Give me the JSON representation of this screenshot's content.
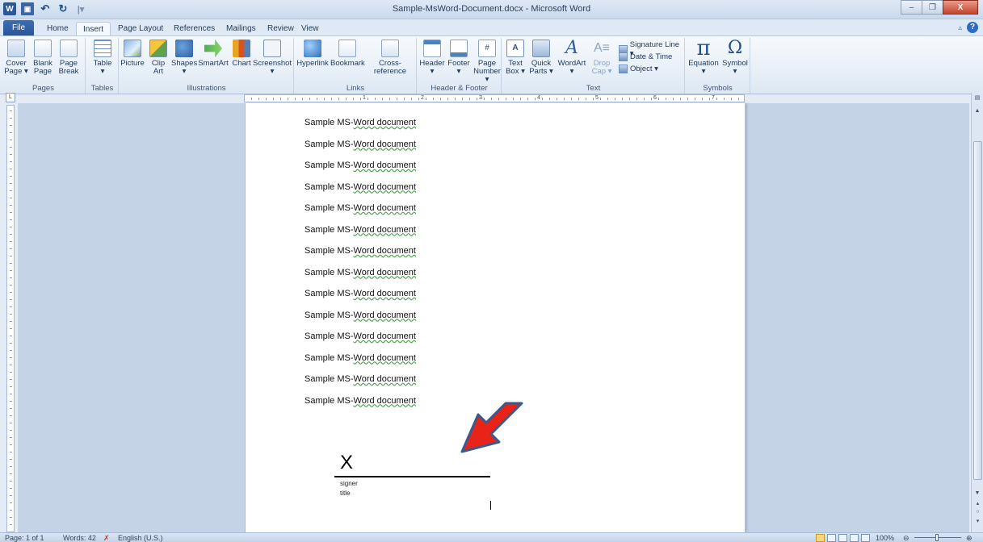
{
  "window": {
    "title": "Sample-MsWord-Document.docx - Microsoft Word",
    "minimize": "–",
    "restore": "❐",
    "close": "X"
  },
  "qat": {
    "word_icon": "W",
    "save_icon": "💾",
    "undo_icon": "↶",
    "redo_icon": "↻",
    "customize": "|▾"
  },
  "tabs": [
    {
      "label": "File"
    },
    {
      "label": "Home"
    },
    {
      "label": "Insert"
    },
    {
      "label": "Page Layout"
    },
    {
      "label": "References"
    },
    {
      "label": "Mailings"
    },
    {
      "label": "Review"
    },
    {
      "label": "View"
    }
  ],
  "active_tab": "Insert",
  "ribbon": {
    "pages": {
      "label": "Pages",
      "cover": "Cover\nPage ▾",
      "blank": "Blank\nPage",
      "break": "Page\nBreak"
    },
    "tables": {
      "label": "Tables",
      "table": "Table\n▾"
    },
    "illustrations": {
      "label": "Illustrations",
      "picture": "Picture",
      "clipart": "Clip\nArt",
      "shapes": "Shapes\n▾",
      "smartart": "SmartArt",
      "chart": "Chart",
      "screenshot": "Screenshot\n▾"
    },
    "links": {
      "label": "Links",
      "hyperlink": "Hyperlink",
      "bookmark": "Bookmark",
      "crossref": "Cross-reference"
    },
    "header_footer": {
      "label": "Header & Footer",
      "header": "Header\n▾",
      "footer": "Footer\n▾",
      "pagenum": "Page\nNumber ▾"
    },
    "text": {
      "label": "Text",
      "textbox": "Text\nBox ▾",
      "quickparts": "Quick\nParts ▾",
      "wordart": "WordArt\n▾",
      "dropcap": "Drop\nCap ▾",
      "sigline": "Signature Line ▾",
      "datetime": "Date & Time",
      "object": "Object ▾"
    },
    "symbols": {
      "label": "Symbols",
      "equation": "Equation\n▾",
      "symbol": "Symbol\n▾",
      "pi": "π",
      "omega": "Ω"
    }
  },
  "ruler": {
    "numbers": [
      "1",
      "2",
      "3",
      "4",
      "5",
      "6",
      "7"
    ],
    "tab_selector": "L"
  },
  "document": {
    "lines": [
      {
        "prefix": "Sample MS-",
        "squiggle": "Word document"
      },
      {
        "prefix": "Sample MS-",
        "squiggle": "Word document"
      },
      {
        "prefix": "Sample MS-",
        "squiggle": "Word document"
      },
      {
        "prefix": "Sample MS-",
        "squiggle": "Word document"
      },
      {
        "prefix": "Sample MS-",
        "squiggle": "Word document"
      },
      {
        "prefix": "Sample MS-",
        "squiggle": "Word document"
      },
      {
        "prefix": "Sample MS-",
        "squiggle": "Word document"
      },
      {
        "prefix": "Sample MS-",
        "squiggle": "Word document"
      },
      {
        "prefix": "Sample MS-",
        "squiggle": "Word document"
      },
      {
        "prefix": "Sample MS-",
        "squiggle": "Word document"
      },
      {
        "prefix": "Sample MS-",
        "squiggle": "Word document"
      },
      {
        "prefix": "Sample MS-",
        "squiggle": "Word document"
      },
      {
        "prefix": "Sample MS-",
        "squiggle": "Word document"
      },
      {
        "prefix": "Sample MS-",
        "squiggle": "Word document"
      }
    ],
    "signature": {
      "x": "X",
      "signer": "signer",
      "title": "title"
    },
    "arrow_color": "#e8231a"
  },
  "status": {
    "page": "Page: 1 of 1",
    "words": "Words: 42",
    "language": "English (U.S.)",
    "zoom": "100%",
    "zoom_level": 1.0
  },
  "colors": {
    "accent": "#2b5797",
    "arrow_fill": "#e8231a",
    "arrow_border": "#3b5a8a"
  }
}
